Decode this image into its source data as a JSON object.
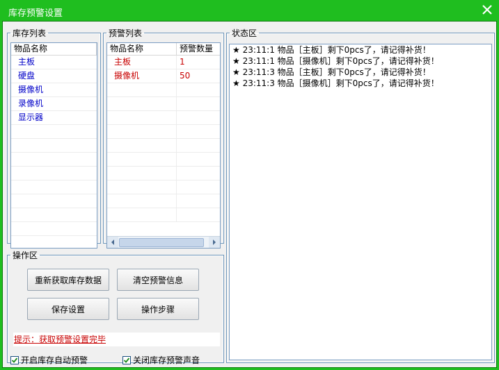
{
  "window": {
    "title": "库存预警设置"
  },
  "inventory": {
    "legend": "库存列表",
    "column": "物品名称",
    "items": [
      "主板",
      "硬盘",
      "摄像机",
      "录像机",
      "显示器"
    ]
  },
  "warning": {
    "legend": "预警列表",
    "columns": [
      "物品名称",
      "预警数量"
    ],
    "rows": [
      {
        "name": "主板",
        "qty": "1"
      },
      {
        "name": "摄像机",
        "qty": "50"
      }
    ]
  },
  "operations": {
    "legend": "操作区",
    "buttons": {
      "refresh": "重新获取库存数据",
      "clear": "清空预警信息",
      "save": "保存设置",
      "steps": "操作步骤"
    },
    "hint": "提示：获取预警设置完毕",
    "checkboxes": {
      "auto_warning": {
        "label": "开启库存自动预警",
        "checked": true
      },
      "mute_sound": {
        "label": "关闭库存预警声音",
        "checked": true
      }
    }
  },
  "status": {
    "legend": "状态区",
    "lines": [
      "★ 23:11:1 物品［主板］剩下0pcs了，请记得补货！",
      "★ 23:11:1 物品［摄像机］剩下0pcs了，请记得补货！",
      "★ 23:11:3 物品［主板］剩下0pcs了，请记得补货！",
      "★ 23:11:3 物品［摄像机］剩下0pcs了，请记得补货！"
    ]
  },
  "colors": {
    "title_bar": "#1fbe1f",
    "item_blue": "#0000c8",
    "item_red": "#c80000"
  },
  "icons": {
    "close": "close-icon",
    "check": "check-icon"
  }
}
